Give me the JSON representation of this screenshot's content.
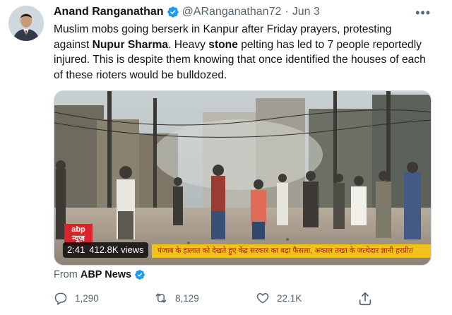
{
  "tweet": {
    "display_name": "Anand Ranganathan",
    "handle": "@ARanganathan72",
    "separator": "·",
    "date": "Jun 3",
    "more_label": "•••",
    "text_segments": [
      "Muslim mobs going berserk in Kanpur after Friday prayers, protesting against ",
      "Nupur Sharma",
      ". Heavy ",
      "stone",
      " pelting has led to 7 people reportedly injured. This is despite them knowing that once identified the houses of each of these rioters would be bulldozed."
    ]
  },
  "media": {
    "channel_logo": "abp न्यूज़",
    "ticker": "पंजाब के हालात को देखते हुए केंद्र सरकार का बड़ा फैसला, अकाल तख्त के जत्थेदार ज्ञानी हरप्रीत",
    "duration": "2:41",
    "views": "412.8K views"
  },
  "source": {
    "prefix": "From",
    "name": "ABP News"
  },
  "actions": {
    "replies": "1,290",
    "retweets": "8,129",
    "likes": "22.1K"
  },
  "icons": {
    "verified": "verified-badge-icon",
    "reply": "reply-icon",
    "retweet": "retweet-icon",
    "like": "heart-icon",
    "share": "share-icon",
    "more": "more-dots-icon"
  },
  "colors": {
    "verified_blue": "#1d9bf0",
    "text_primary": "#0f1419",
    "text_secondary": "#536471",
    "ticker_yellow": "#f2c21b",
    "logo_red": "#d9242b"
  }
}
